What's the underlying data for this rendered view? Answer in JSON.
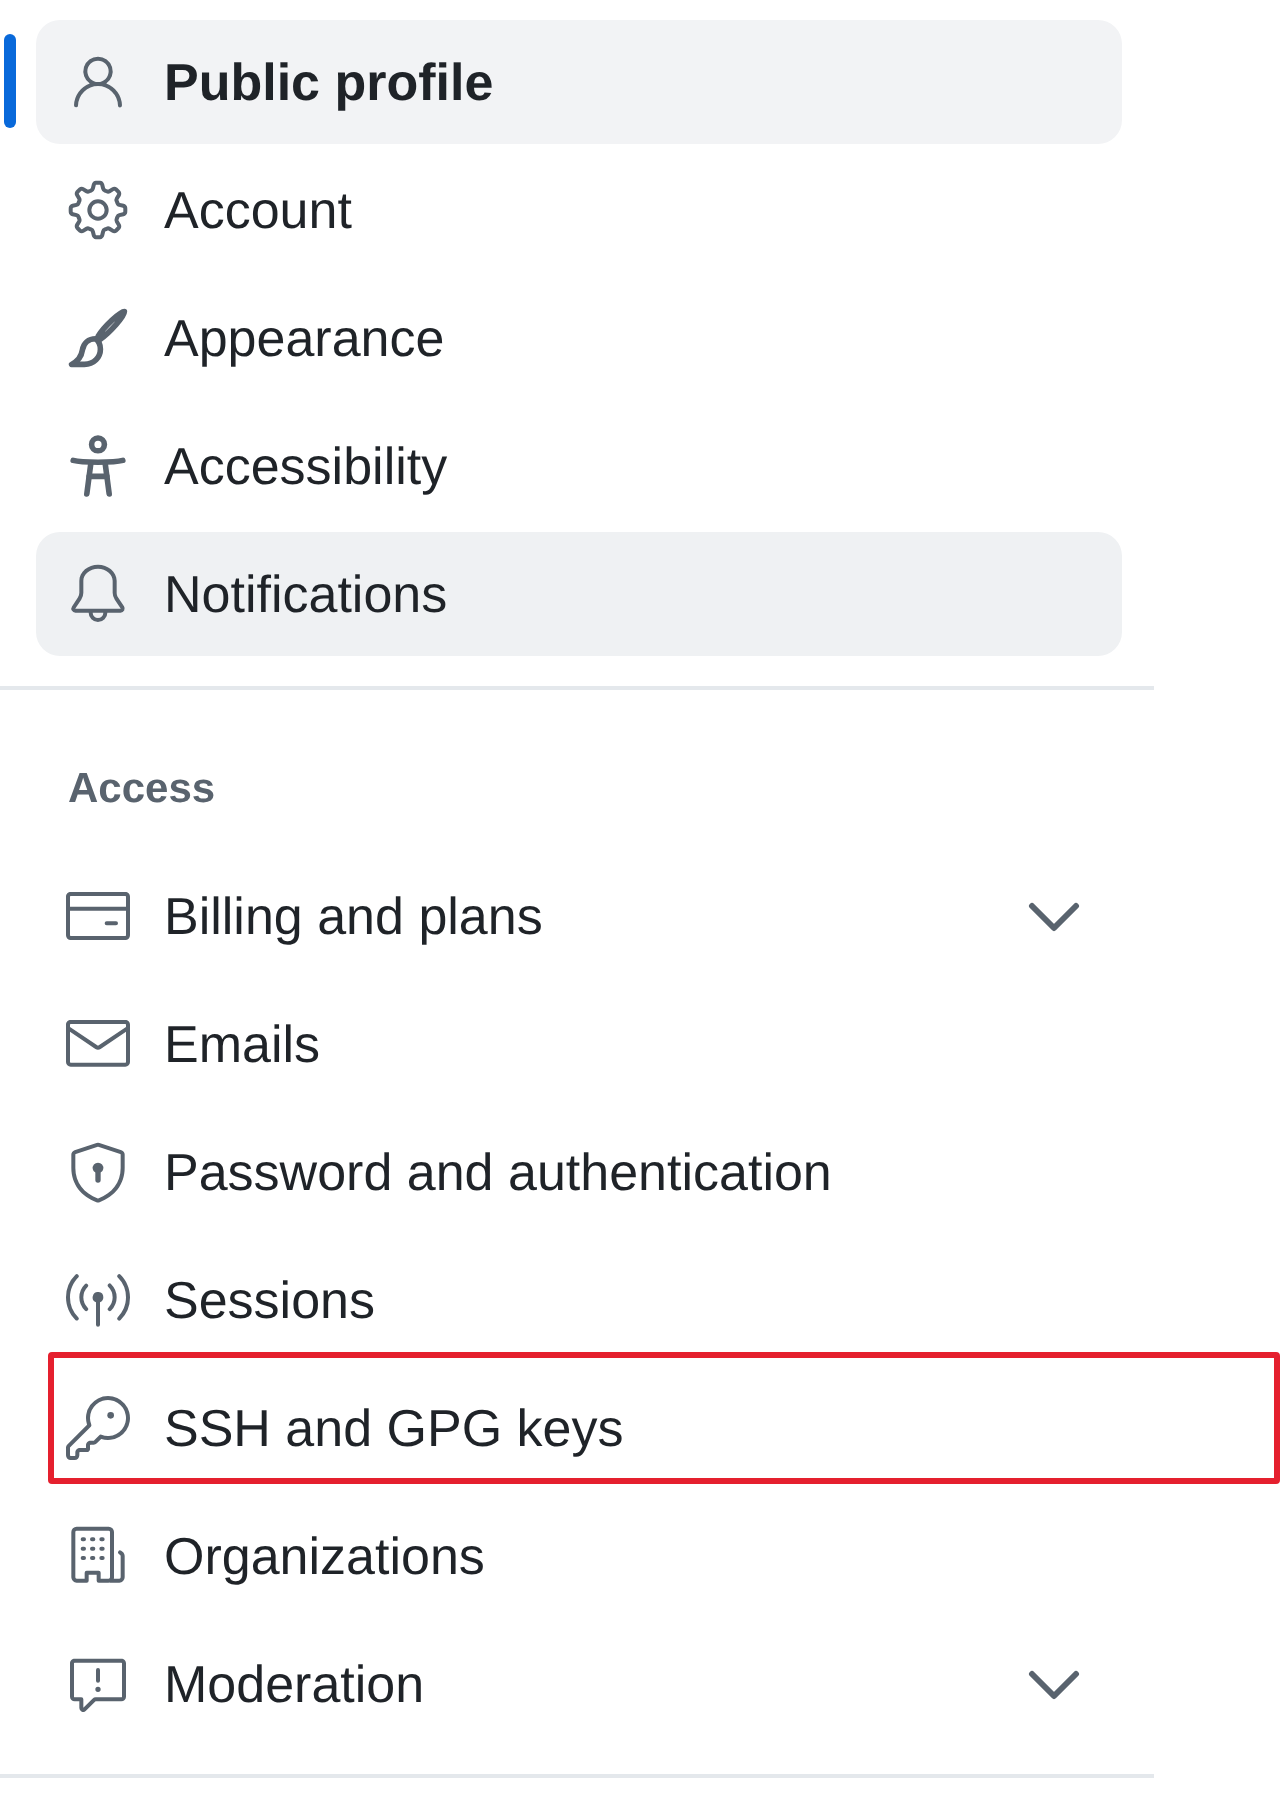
{
  "sections": [
    {
      "items": [
        {
          "label": "Public profile",
          "kind": "link",
          "selected": true,
          "hovered": false,
          "outlined": false
        },
        {
          "label": "Account",
          "kind": "link",
          "selected": false,
          "hovered": false,
          "outlined": false
        },
        {
          "label": "Appearance",
          "kind": "link",
          "selected": false,
          "hovered": false,
          "outlined": false
        },
        {
          "label": "Accessibility",
          "kind": "link",
          "selected": false,
          "hovered": false,
          "outlined": false
        },
        {
          "label": "Notifications",
          "kind": "link",
          "selected": false,
          "hovered": true,
          "outlined": false
        }
      ]
    },
    {
      "heading": "Access",
      "items": [
        {
          "label": "Billing and plans",
          "kind": "collapsible",
          "expanded": false,
          "selected": false,
          "hovered": false,
          "outlined": false
        },
        {
          "label": "Emails",
          "kind": "link",
          "selected": false,
          "hovered": false,
          "outlined": false
        },
        {
          "label": "Password and authentication",
          "kind": "link",
          "selected": false,
          "hovered": false,
          "outlined": false
        },
        {
          "label": "Sessions",
          "kind": "link",
          "selected": false,
          "hovered": false,
          "outlined": false
        },
        {
          "label": "SSH and GPG keys",
          "kind": "link",
          "selected": false,
          "hovered": false,
          "outlined": true
        },
        {
          "label": "Organizations",
          "kind": "link",
          "selected": false,
          "hovered": false,
          "outlined": false
        },
        {
          "label": "Moderation",
          "kind": "collapsible",
          "expanded": false,
          "selected": false,
          "hovered": false,
          "outlined": false
        }
      ]
    }
  ]
}
